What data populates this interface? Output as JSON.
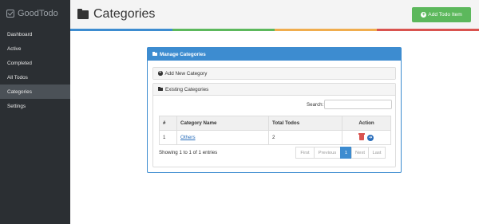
{
  "app": {
    "brand": "GoodTodo"
  },
  "sidebar": {
    "items": [
      {
        "label": "Dashboard"
      },
      {
        "label": "Active"
      },
      {
        "label": "Completed"
      },
      {
        "label": "All Todos"
      },
      {
        "label": "Categories",
        "active": true
      },
      {
        "label": "Settings"
      }
    ]
  },
  "header": {
    "title": "Categories",
    "add_button": "Add Todo Item",
    "stripe_colors": [
      "#3d8cd0",
      "#5cb85c",
      "#f0ad4e",
      "#d9534f"
    ]
  },
  "panel": {
    "title": "Manage Categories",
    "add_new": "Add New Category",
    "existing": "Existing Categories"
  },
  "search": {
    "label": "Search:",
    "value": ""
  },
  "table": {
    "headers": [
      "#",
      "Category Name",
      "Total Todos",
      "Action"
    ],
    "rows": [
      {
        "num": "1",
        "name": "Others",
        "total": "2"
      }
    ]
  },
  "info": "Showing 1 to 1 of 1 entries",
  "pagination": {
    "first": "First",
    "previous": "Previous",
    "current": "1",
    "next": "Next",
    "last": "Last"
  },
  "colors": {
    "sidebar": "#2b2f33",
    "primary": "#3d8cd0",
    "success": "#5cb85c",
    "danger": "#d9534f"
  }
}
